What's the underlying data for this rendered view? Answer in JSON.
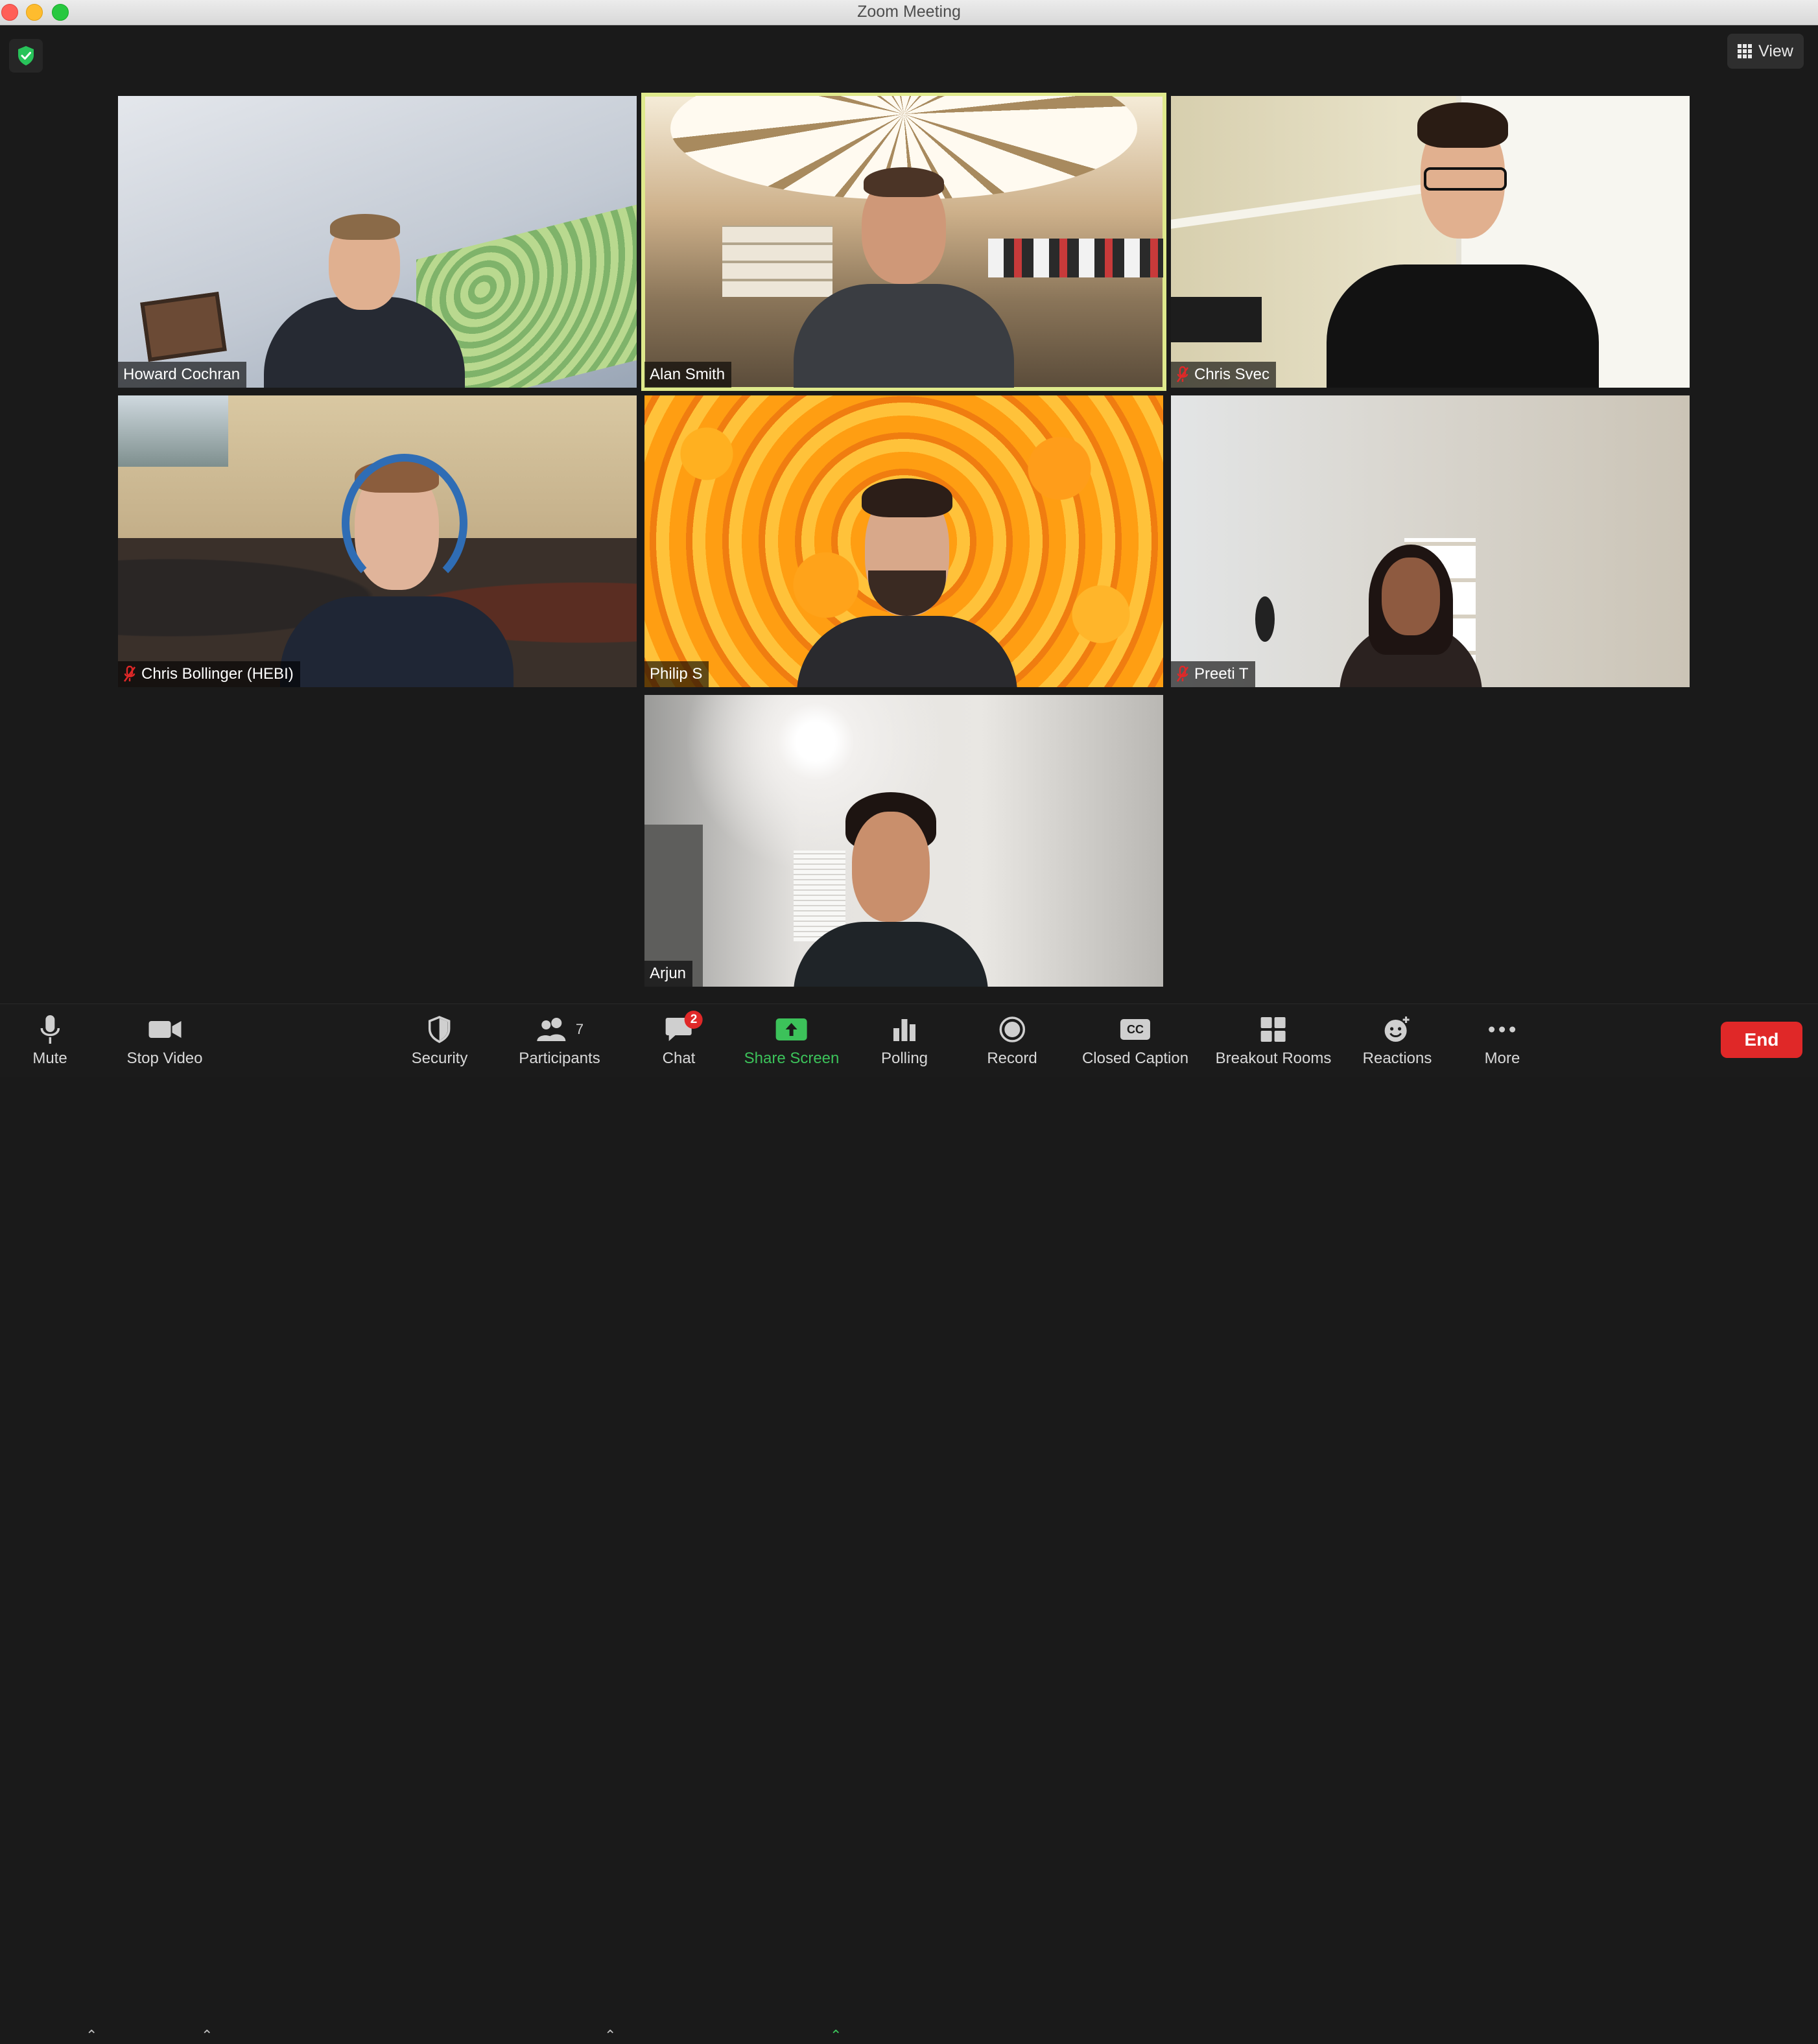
{
  "window": {
    "title": "Zoom Meeting"
  },
  "top_bar": {
    "view_label": "View"
  },
  "participants": [
    {
      "name": "Howard Cochran",
      "muted": false
    },
    {
      "name": "Alan Smith",
      "muted": false,
      "active_speaker": true
    },
    {
      "name": "Chris Svec",
      "muted": true
    },
    {
      "name": "Chris Bollinger (HEBI)",
      "muted": true
    },
    {
      "name": "Philip S",
      "muted": false
    },
    {
      "name": "Preeti T",
      "muted": true
    },
    {
      "name": "Arjun",
      "muted": false
    }
  ],
  "toolbar": {
    "mute": "Mute",
    "stop_video": "Stop Video",
    "security": "Security",
    "participants": "Participants",
    "participants_count": "7",
    "chat": "Chat",
    "chat_badge": "2",
    "share_screen": "Share Screen",
    "polling": "Polling",
    "record": "Record",
    "closed_caption": "Closed Caption",
    "cc_glyph": "CC",
    "breakout_rooms": "Breakout Rooms",
    "reactions": "Reactions",
    "more": "More",
    "end": "End"
  },
  "colors": {
    "active_speaker_border": "#dfe98c",
    "share_green": "#3cc25a",
    "end_red": "#e02828",
    "muted_icon": "#e02828"
  }
}
